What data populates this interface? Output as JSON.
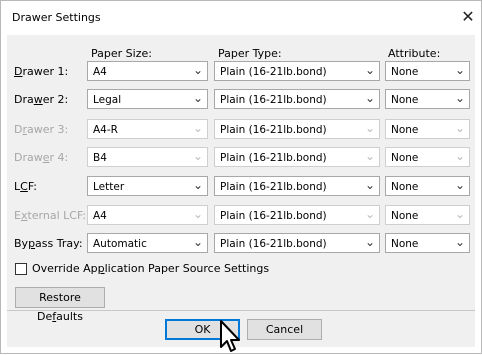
{
  "window": {
    "title": "Drawer Settings"
  },
  "headers": {
    "paper_size": "Paper Size:",
    "paper_type": "Paper Type:",
    "attribute": "Attribute:"
  },
  "rows": [
    {
      "label_pre": "",
      "label_key": "D",
      "label_post": "rawer 1:",
      "enabled": true,
      "size": "A4",
      "type": "Plain (16-21lb.bond)",
      "attribute": "None"
    },
    {
      "label_pre": "Dra",
      "label_key": "w",
      "label_post": "er 2:",
      "enabled": true,
      "size": "Legal",
      "type": "Plain (16-21lb.bond)",
      "attribute": "None"
    },
    {
      "label_pre": "D",
      "label_key": "r",
      "label_post": "awer 3:",
      "enabled": false,
      "size": "A4-R",
      "type": "Plain (16-21lb.bond)",
      "attribute": "None"
    },
    {
      "label_pre": "Draw",
      "label_key": "e",
      "label_post": "r 4:",
      "enabled": false,
      "size": "B4",
      "type": "Plain (16-21lb.bond)",
      "attribute": "None"
    },
    {
      "label_pre": "L",
      "label_key": "C",
      "label_post": "F:",
      "enabled": true,
      "size": "Letter",
      "type": "Plain (16-21lb.bond)",
      "attribute": "None"
    },
    {
      "label_pre": "E",
      "label_key": "x",
      "label_post": "ternal LCF:",
      "enabled": false,
      "size": "A4",
      "type": "Plain (16-21lb.bond)",
      "attribute": "None"
    },
    {
      "label_pre": "By",
      "label_key": "p",
      "label_post": "ass Tray:",
      "enabled": true,
      "size": "Automatic",
      "type": "Plain (16-21lb.bond)",
      "attribute": "None"
    }
  ],
  "override": {
    "pre": "Override Ap",
    "key": "p",
    "post": "lication Paper Source Settings",
    "checked": false
  },
  "buttons": {
    "restore_pre": "Restore De",
    "restore_key": "f",
    "restore_post": "aults",
    "ok": "OK",
    "cancel": "Cancel"
  },
  "icons": {
    "close": "close-icon",
    "dropdown": "chevron-down-icon",
    "cursor": "mouse-pointer-icon"
  }
}
